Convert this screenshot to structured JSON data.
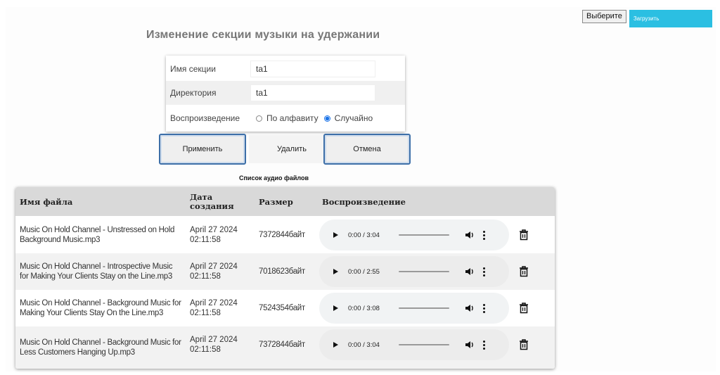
{
  "upload": {
    "choose_label": "Выберите",
    "upload_label": "Загрузить"
  },
  "title": "Изменение секции музыки на удержании",
  "form": {
    "section_name_label": "Имя секции",
    "section_name_value": "ta1",
    "directory_label": "Директория",
    "directory_value": "ta1",
    "playback_label": "Воспроизведение",
    "options": [
      {
        "label": "По алфавиту",
        "checked": false
      },
      {
        "label": "Случайно",
        "checked": true
      }
    ]
  },
  "actions": {
    "apply": "Применить",
    "delete": "Удалить",
    "cancel": "Отмена"
  },
  "list_title": "Список аудио файлов",
  "table": {
    "headers": {
      "name": "Имя файла",
      "date": "Дата создания",
      "size": "Размер",
      "playback": "Воспроизведение"
    },
    "rows": [
      {
        "name": "Music On Hold Channel - Unstressed on Hold Background Music.mp3",
        "date": "April 27 2024 02:11:58",
        "size": "7372844байт",
        "time": "0:00 / 3:04"
      },
      {
        "name": "Music On Hold Channel - Introspective Music for Making Your Clients Stay on the Line.mp3",
        "date": "April 27 2024 02:11:58",
        "size": "7018623байт",
        "time": "0:00 / 2:55"
      },
      {
        "name": "Music On Hold Channel - Background Music for Making Your Clients Stay On the Line.mp3",
        "date": "April 27 2024 02:11:58",
        "size": "7524354байт",
        "time": "0:00 / 3:08"
      },
      {
        "name": "Music On Hold Channel - Background Music for Less Customers Hanging Up.mp3",
        "date": "April 27 2024 02:11:58",
        "size": "7372844байт",
        "time": "0:00 / 3:04"
      }
    ]
  },
  "colors": {
    "accent": "#2bbfe2",
    "outline": "#3d6fa8",
    "radio_checked": "#1a73e8"
  }
}
